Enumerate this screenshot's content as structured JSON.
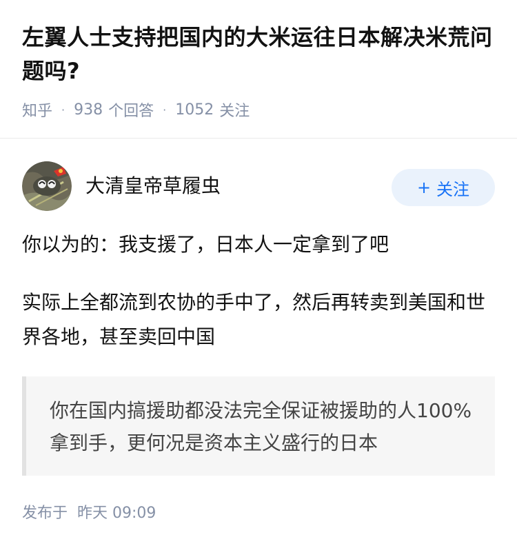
{
  "question": {
    "title": "左翼人士支持把国内的大米运往日本解决米荒问题吗?",
    "meta": {
      "source": "知乎",
      "answer_count": "938",
      "answer_label": "个回答",
      "follower_count": "1052",
      "follower_label": "关注"
    }
  },
  "answer": {
    "author": {
      "name": "大清皇帝草履虫",
      "avatar_icon": "avatar-image"
    },
    "follow_button": {
      "icon": "plus-icon",
      "plus": "+",
      "label": "关注"
    },
    "paragraphs": [
      "你以为的：我支援了，日本人一定拿到了吧",
      "实际上全都流到农协的手中了，然后再转卖到美国和世界各地，甚至卖回中国"
    ],
    "quote": "你在国内搞援助都没法完全保证被援助的人100%拿到手，更何况是资本主义盛行的日本",
    "footer": {
      "published_label": "发布于",
      "published_time": "昨天 09:09"
    }
  },
  "colors": {
    "accent": "#1772f6",
    "follow_bg": "#eaf2fc",
    "meta_text": "#8590a6",
    "quote_bg": "#f6f6f6"
  }
}
